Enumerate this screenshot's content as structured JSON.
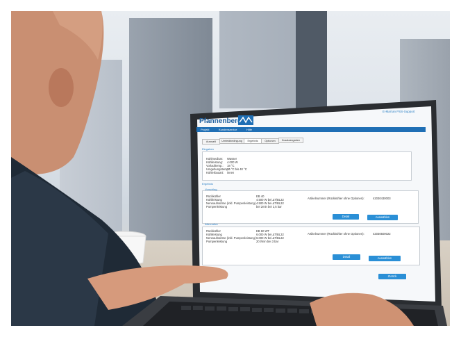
{
  "app": {
    "logo_text": "Pfannenberg",
    "top_link": "E-Mail an PSS-Support",
    "nav": [
      "Projekt",
      "Kundenservice",
      "Hilfe"
    ],
    "tabs": [
      "Auswahl",
      "Umfeldbedingung",
      "Ergebnis",
      "Optionen",
      "Zusatzangaben"
    ],
    "active_tab_index": 2,
    "section_input": {
      "title": "Eingaben",
      "rows": [
        {
          "label": "Kühlmedium:",
          "value": "Wasser"
        },
        {
          "label": "Kühlleistung:",
          "value": "4.000 W"
        },
        {
          "label": "Vorlauftemp.:",
          "value": "18 °C"
        },
        {
          "label": "Umgebungstemp.:",
          "value": "15 °C bis 40 °C"
        },
        {
          "label": "Kühlerbauart:",
          "value": "innen"
        }
      ]
    },
    "section_result": {
      "title": "Ergebnis",
      "group1": {
        "title": "Vorschlag",
        "rows": [
          {
            "label": "Rückkühler",
            "value": "EB 40"
          },
          {
            "label": "Kühlleistung",
            "value": "4.500 W bei ΔT/BL32"
          },
          {
            "label": "Nennaufnahme (inkl. Pumpenleistung)",
            "value": "4.500 W bei ΔT/BL32"
          },
          {
            "label": "Pumpenleistung",
            "value": "bei 2min bei 2,5 bar"
          }
        ],
        "article_label": "Artikelnummer (Rückkühler ohne Optionen):",
        "article_number": "42030430003",
        "btn_details": "Detail",
        "btn_select": "Auswählen"
      },
      "group2": {
        "title": "Alternative",
        "rows": [
          {
            "label": "Rückkühler",
            "value": "EB 60 WT"
          },
          {
            "label": "Kühlleistung",
            "value": "6.000 W bei ΔT/BL32"
          },
          {
            "label": "Nennaufnahme (inkl. Pumpenleistung)",
            "value": "6.000 W bei ΔT/BL32"
          },
          {
            "label": "Pumpenleistung",
            "value": "20 l/min bei 3 bar"
          }
        ],
        "article_label": "Artikelnummer (Rückkühler ohne Optionen):",
        "article_number": "42030500022",
        "btn_details": "Detail",
        "btn_select": "Auswählen"
      }
    },
    "btn_back": "Zurück"
  },
  "colors": {
    "brand_blue": "#2a8fd6",
    "header_bar": "#1f6fb5",
    "frame_border": "#1aa0d8"
  }
}
